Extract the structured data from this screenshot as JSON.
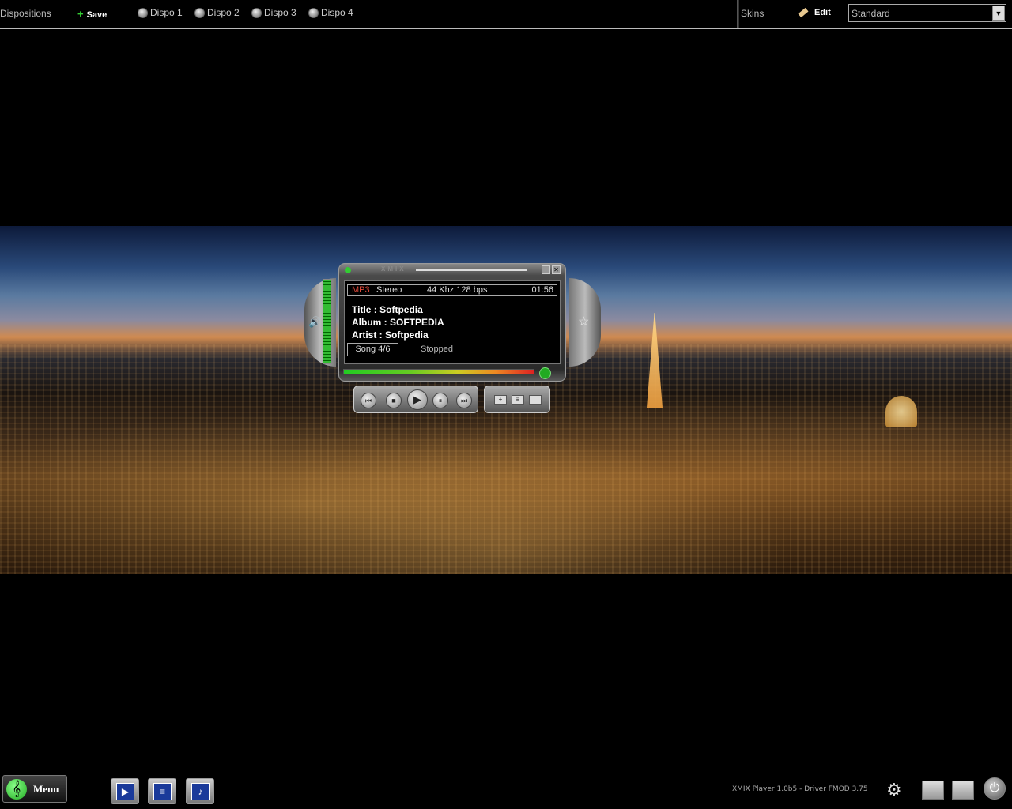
{
  "toolbar": {
    "dispositions_label": "Dispositions",
    "save_label": "Save",
    "dispos": [
      "Dispo 1",
      "Dispo 2",
      "Dispo 3",
      "Dispo 4"
    ],
    "skins_label": "Skins",
    "edit_label": "Edit",
    "skin_selected": "Standard"
  },
  "player": {
    "logo": "XMIX",
    "format": "MP3",
    "mode": "Stereo",
    "rate": "44 Khz  128 bps",
    "time": "01:56",
    "title": "Title : Softpedia",
    "album": "Album : SOFTPEDIA",
    "artist": "Artist : Softpedia",
    "song": "Song 4/6",
    "status": "Stopped"
  },
  "bottom": {
    "menu_label": "Menu",
    "footer": "XMIX Player 1.0b5 - Driver FMOD 3.75"
  },
  "colors": {
    "format_accent": "#e24a3a",
    "led": "#33cc33"
  }
}
